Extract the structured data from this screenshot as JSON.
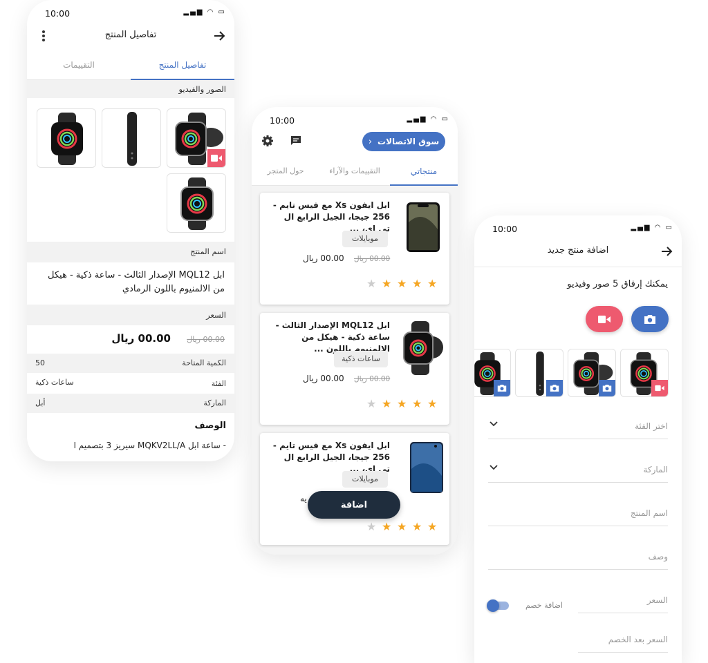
{
  "colors": {
    "primary": "#4472c4",
    "danger": "#ee5a6f",
    "dark": "#1f2d3d",
    "star": "#f5a623",
    "star_off": "#cccccc"
  },
  "status": {
    "time": "10:00"
  },
  "phone1": {
    "title": "تفاصيل المنتج",
    "tabs": [
      "تفاصيل المنتج",
      "التقييمات"
    ],
    "media_label": "الصور والفيديو",
    "name_label": "اسم المنتج",
    "product_name": "ابل MQL12 الإصدار الثالث - ساعة ذكية - هيكل من الالمنيوم باللون الرمادي",
    "price_label": "السعر",
    "price_current": "00.00 ريال",
    "price_old": "00.00 ريال",
    "rows": [
      {
        "label": "الكمية المتاحة",
        "value": "50"
      },
      {
        "label": "الفئة",
        "value": "ساعات ذكية"
      },
      {
        "label": "الماركة",
        "value": "أبل"
      }
    ],
    "desc_title": "الوصف",
    "desc_partial": "- ساعة ابل MQKV2LL/A سيريز 3 بتصميم ا"
  },
  "phone2": {
    "store_button": "سوق الاتصالات",
    "tabs": [
      "منتجاتي",
      "التقييمات والآراء",
      "حول المتجر"
    ],
    "products": [
      {
        "title": "ابل ايفون Xs مع فيس تايم - 256 جيجا، الجيل الرابع ال تي اي، ...",
        "category": "موبايلات",
        "price": "00.00 ريال",
        "old_price": "00.00 ريال",
        "rating": 4,
        "image": "iphone-xs"
      },
      {
        "title": "ابل MQL12 الإصدار الثالث - ساعة ذكية - هيكل من الالمنيوم باللون ...",
        "category": "ساعات ذكية",
        "price": "00.00 ريال",
        "old_price": "00.00 ريال",
        "rating": 4,
        "image": "apple-watch"
      },
      {
        "title": "ابل ايفون Xs مع فيس تايم - 256 جيجا، الجيل الرابع ال تي اي، ...",
        "category": "موبايلات",
        "price": "",
        "old_price": "",
        "rating": 4,
        "image": "galaxy-phone"
      }
    ],
    "partial_text": "يه",
    "fab_label": "اضافة"
  },
  "phone3": {
    "title": "اضافة منتج جديد",
    "upload_hint": "يمكنك إرفاق 5 صور وفيديو",
    "fields": {
      "category": "اختر الفئة",
      "brand": "الماركة",
      "name": "اسم المنتج",
      "description": "وصف",
      "price": "السعر",
      "discount_toggle": "اضافة خصم",
      "price_after": "السعر بعد الخصم"
    }
  }
}
